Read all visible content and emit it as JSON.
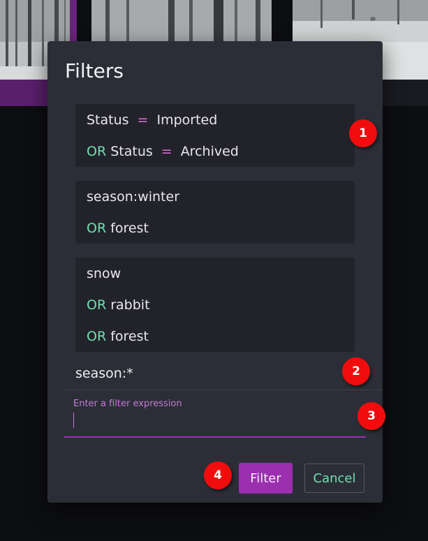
{
  "dialog": {
    "title": "Filters",
    "groups": [
      {
        "lines": [
          {
            "field": "Status",
            "eq": "=",
            "value": "Imported"
          },
          {
            "op": "OR",
            "field": "Status",
            "eq": "=",
            "value": "Archived"
          }
        ]
      },
      {
        "lines": [
          {
            "term": "season:winter"
          },
          {
            "op": "OR",
            "term": "forest"
          }
        ]
      },
      {
        "lines": [
          {
            "term": "snow"
          },
          {
            "op": "OR",
            "term": "rabbit"
          },
          {
            "op": "OR",
            "term": "forest"
          }
        ]
      }
    ],
    "pending_expression": "season:*",
    "input": {
      "label": "Enter a filter expression",
      "value": ""
    },
    "buttons": {
      "filter": "Filter",
      "cancel": "Cancel"
    }
  },
  "callouts": [
    "1",
    "2",
    "3",
    "4"
  ],
  "colors": {
    "accent": "#9b2fb0",
    "or_operator": "#6fe0b0",
    "eq_operator": "#e06fd6",
    "callout": "#f10d0d"
  }
}
